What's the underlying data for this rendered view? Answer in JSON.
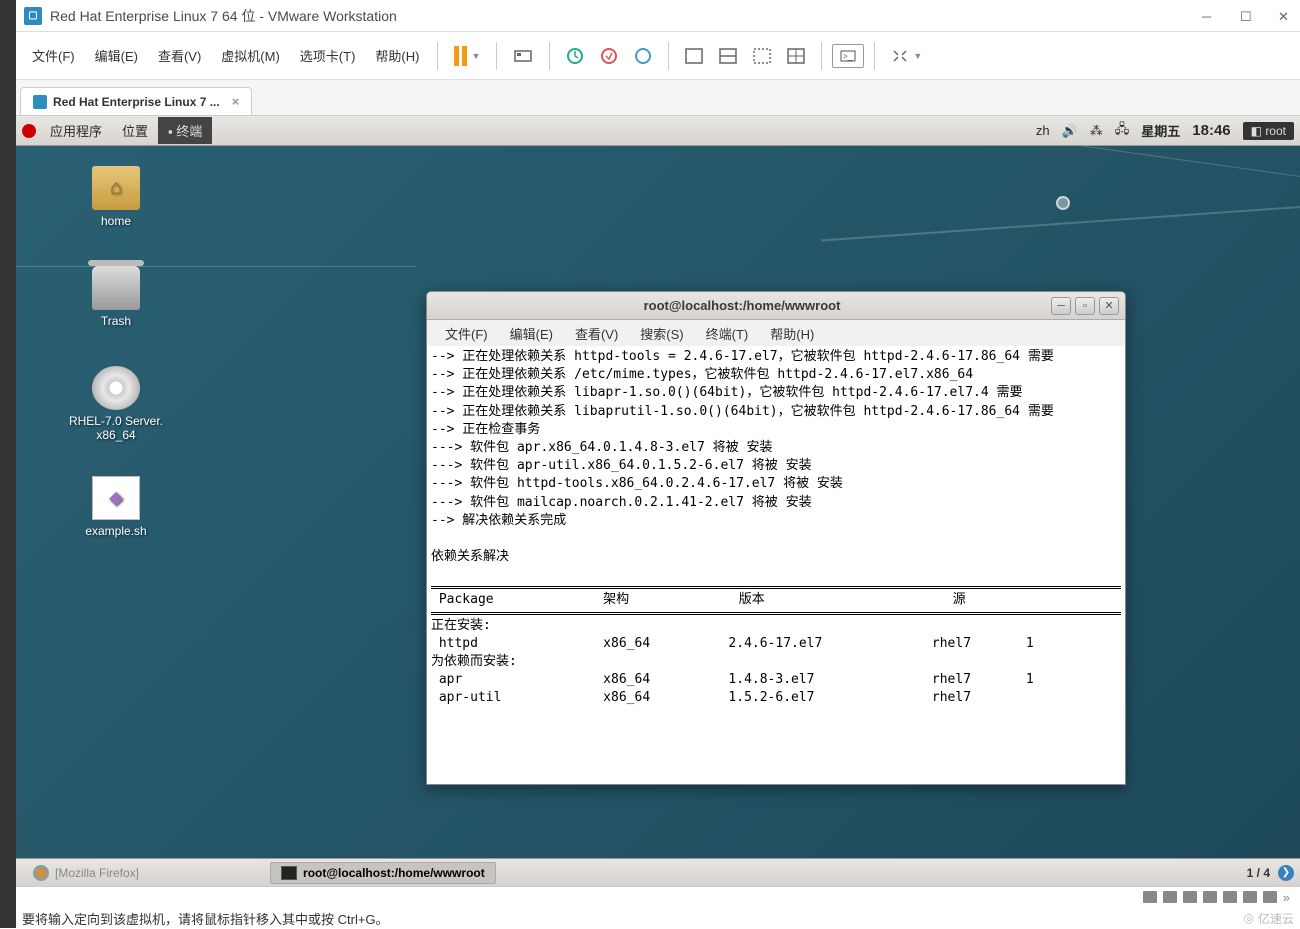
{
  "vmware": {
    "title": "Red Hat Enterprise Linux 7 64 位 - VMware Workstation",
    "menu": {
      "file": "文件(F)",
      "edit": "编辑(E)",
      "view": "查看(V)",
      "vm": "虚拟机(M)",
      "tabs": "选项卡(T)",
      "help": "帮助(H)"
    },
    "tab_label": "Red Hat Enterprise Linux 7 ...",
    "status_msg": "要将输入定向到该虚拟机，请将鼠标指针移入其中或按 Ctrl+G。",
    "watermark": "亿速云"
  },
  "gnome": {
    "apps": "应用程序",
    "places": "位置",
    "terminal": "终端",
    "lang": "zh",
    "day": "星期五",
    "time": "18:46",
    "user": "root",
    "icons": {
      "home": "home",
      "trash": "Trash",
      "disc": "RHEL-7.0 Server.\nx86_64",
      "example": "example.sh"
    },
    "taskbar": {
      "firefox": "[Mozilla Firefox]",
      "terminal": "root@localhost:/home/wwwroot",
      "workspace": "1 / 4"
    }
  },
  "terminal": {
    "title": "root@localhost:/home/wwwroot",
    "menu": {
      "file": "文件(F)",
      "edit": "编辑(E)",
      "view": "查看(V)",
      "search": "搜索(S)",
      "term": "终端(T)",
      "help": "帮助(H)"
    },
    "lines": [
      "--> 正在处理依赖关系 httpd-tools = 2.4.6-17.el7，它被软件包 httpd-2.4.6-17.86_64 需要",
      "--> 正在处理依赖关系 /etc/mime.types，它被软件包 httpd-2.4.6-17.el7.x86_64",
      "--> 正在处理依赖关系 libapr-1.so.0()(64bit)，它被软件包 httpd-2.4.6-17.el7.4 需要",
      "--> 正在处理依赖关系 libaprutil-1.so.0()(64bit)，它被软件包 httpd-2.4.6-17.86_64 需要",
      "--> 正在检查事务",
      "---> 软件包 apr.x86_64.0.1.4.8-3.el7 将被 安装",
      "---> 软件包 apr-util.x86_64.0.1.5.2-6.el7 将被 安装",
      "---> 软件包 httpd-tools.x86_64.0.2.4.6-17.el7 将被 安装",
      "---> 软件包 mailcap.noarch.0.2.1.41-2.el7 将被 安装",
      "--> 解决依赖关系完成",
      "",
      "依赖关系解决",
      ""
    ],
    "table": {
      "headers": {
        "pkg": " Package",
        "arch": "架构",
        "ver": "版本",
        "src": "源"
      },
      "section_install": "正在安装:",
      "section_deps": "为依赖而安装:",
      "rows": [
        {
          "pkg": " httpd",
          "arch": "x86_64",
          "ver": "2.4.6-17.el7",
          "src": "rhel7",
          "extra": "1"
        },
        {
          "pkg": " apr",
          "arch": "x86_64",
          "ver": "1.4.8-3.el7",
          "src": "rhel7",
          "extra": "1"
        },
        {
          "pkg": " apr-util",
          "arch": "x86_64",
          "ver": "1.5.2-6.el7",
          "src": "rhel7",
          "extra": ""
        }
      ]
    }
  }
}
